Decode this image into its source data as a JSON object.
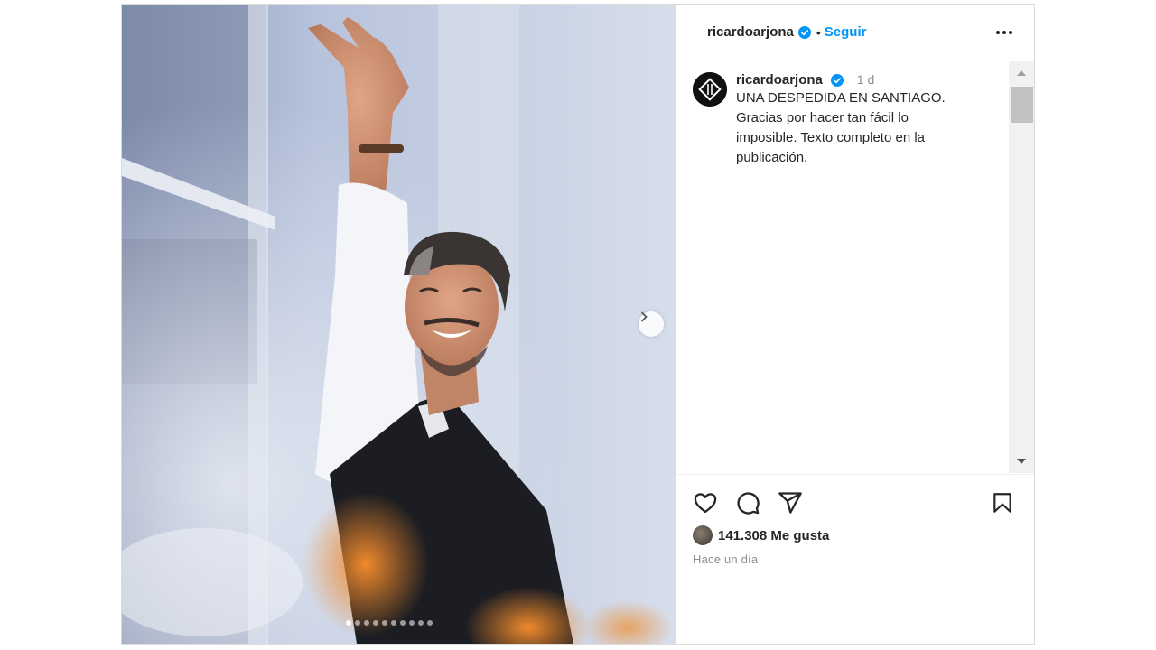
{
  "post": {
    "username": "ricardoarjona",
    "follow_label": "Seguir",
    "separator": "•",
    "caption": {
      "username": "ricardoarjona",
      "time": "1 d",
      "text": "UNA DESPEDIDA EN SANTIAGO.\nGracias por hacer tan fácil lo\nimposible. Texto completo en la\npublicación."
    },
    "likes_text": "141.308 Me gusta",
    "posted_text": "Hace un día",
    "carousel": {
      "total_slides": 10,
      "active_index": 0
    }
  },
  "icons": {
    "verified": "verified-badge-icon",
    "more": "more-options-icon",
    "like": "heart-icon",
    "comment": "comment-icon",
    "share": "paper-plane-icon",
    "save": "bookmark-icon",
    "next": "chevron-right-icon"
  },
  "colors": {
    "accent": "#0095f6",
    "text": "#262626",
    "muted": "#8e8e8e",
    "border": "#dbdbdb"
  }
}
